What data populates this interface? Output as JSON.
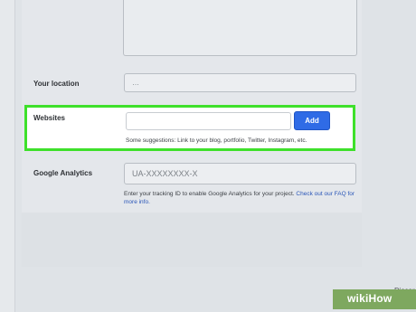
{
  "location": {
    "label": "Your location",
    "value": "…"
  },
  "websites": {
    "label": "Websites",
    "input_value": "",
    "add_label": "Add",
    "hint": "Some suggestions: Link to your blog, portfolio, Twitter, Instagram, etc."
  },
  "analytics": {
    "label": "Google Analytics",
    "placeholder": "UA-XXXXXXXX-X",
    "hint_text": "Enter your tracking ID to enable Google Analytics for your project. ",
    "hint_link": "Check out our FAQ for more info."
  },
  "footer": {
    "discard_label": "Discar"
  },
  "watermark": {
    "text": "wikiHow"
  },
  "colors": {
    "highlight": "#3ee02b",
    "button": "#2f6be6",
    "link": "#2a56b8"
  }
}
